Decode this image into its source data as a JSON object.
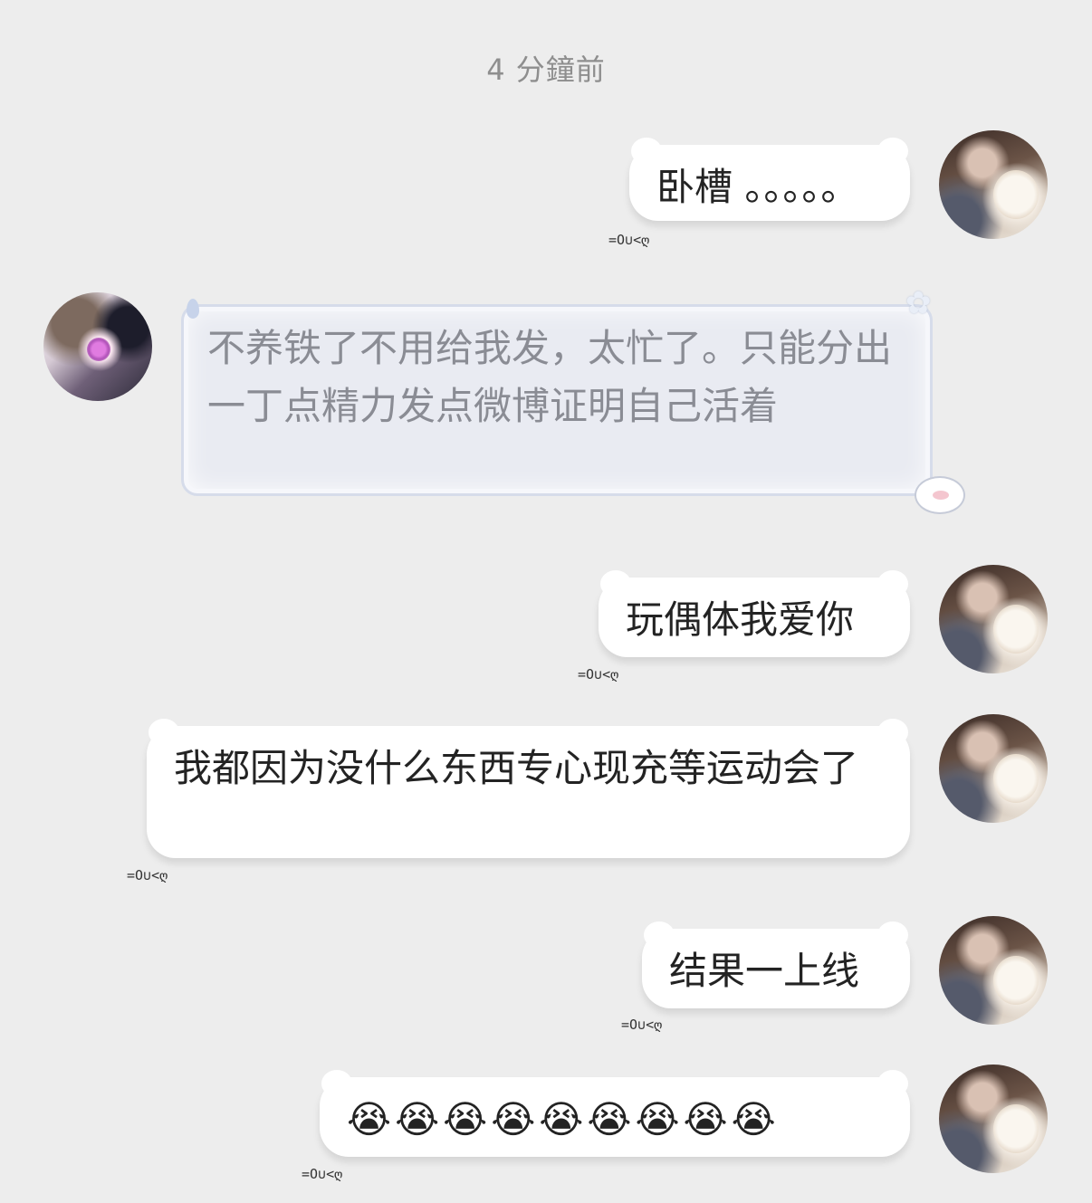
{
  "timestamp": "4 分鐘前",
  "messages": [
    {
      "sender": "me",
      "text": "卧槽 。。。。。",
      "deco": "=O∪<ღ"
    },
    {
      "sender": "other",
      "text": "不养铁了不用给我发，太忙了。只能分出一丁点精力发点微博证明自己活着"
    },
    {
      "sender": "me",
      "text": "玩偶体我爱你",
      "deco": "=O∪<ღ"
    },
    {
      "sender": "me",
      "text": "我都因为没什么东西专心现充等运动会了",
      "deco": "=O∪<ღ"
    },
    {
      "sender": "me",
      "text": "结果一上线",
      "deco": "=O∪<ღ"
    },
    {
      "sender": "me",
      "text": "😭😭😭😭😭😭😭😭😭",
      "deco": "=O∪<ღ"
    }
  ]
}
